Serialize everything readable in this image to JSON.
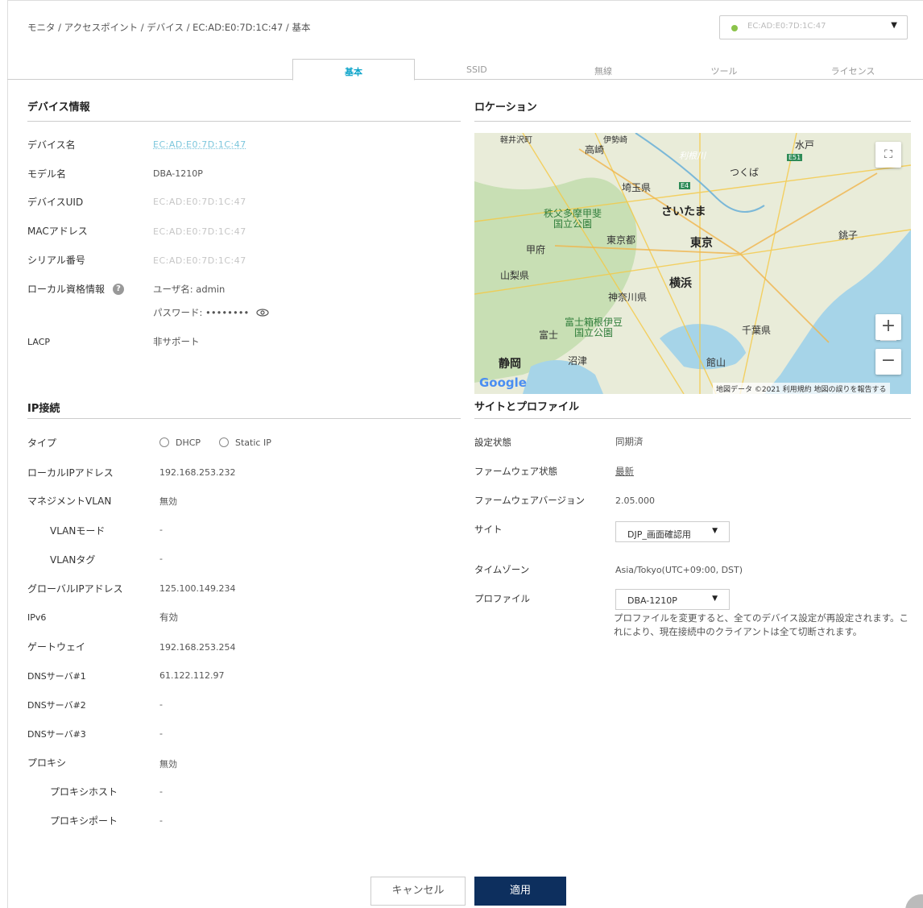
{
  "breadcrumb": "モニタ / アクセスポイント / デバイス / EC:AD:E0:7D:1C:47 / 基本",
  "device_selector": {
    "value": "EC:AD:E0:7D:1C:47",
    "status_color": "#8bc34a"
  },
  "tabs": [
    {
      "label": "基本",
      "active": true
    },
    {
      "label": "SSID"
    },
    {
      "label": "無線"
    },
    {
      "label": "ツール"
    },
    {
      "label": "ライセンス"
    }
  ],
  "device_info": {
    "title": "デバイス情報",
    "device_name_label": "デバイス名",
    "device_name_value": "EC:AD:E0:7D:1C:47",
    "model_label": "モデル名",
    "model_value": "DBA-1210P",
    "uid_label": "デバイスUID",
    "uid_value": "EC:AD:E0:7D:1C:47",
    "mac_label": "MACアドレス",
    "mac_value": "EC:AD:E0:7D:1C:47",
    "serial_label": "シリアル番号",
    "serial_value": "EC:AD:E0:7D:1C:47",
    "credentials_label": "ローカル資格情報",
    "username_text": "ユーザ名: admin",
    "password_text": "パスワード: ••••••••",
    "lacp_label": "LACP",
    "lacp_value": "非サポート"
  },
  "ip": {
    "title": "IP接続",
    "type_label": "タイプ",
    "dhcp_label": "DHCP",
    "static_label": "Static IP",
    "local_ip_label": "ローカルIPアドレス",
    "local_ip_value": "192.168.253.232",
    "mgmt_vlan_label": "マネジメントVLAN",
    "mgmt_vlan_value": "無効",
    "vlan_mode_label": "VLANモード",
    "vlan_mode_value": "-",
    "vlan_tag_label": "VLANタグ",
    "vlan_tag_value": "-",
    "global_ip_label": "グローバルIPアドレス",
    "global_ip_value": "125.100.149.234",
    "ipv6_label": "IPv6",
    "ipv6_value": "有効",
    "gateway_label": "ゲートウェイ",
    "gateway_value": "192.168.253.254",
    "dns1_label": "DNSサーバ#1",
    "dns1_value": "61.122.112.97",
    "dns2_label": "DNSサーバ#2",
    "dns2_value": "-",
    "dns3_label": "DNSサーバ#3",
    "dns3_value": "-",
    "proxy_label": "プロキシ",
    "proxy_value": "無効",
    "proxy_host_label": "プロキシホスト",
    "proxy_host_value": "-",
    "proxy_port_label": "プロキシポート",
    "proxy_port_value": "-"
  },
  "location": {
    "title": "ロケーション",
    "map_labels": {
      "karuizawa": "軽井沢町",
      "isesaki": "伊勢崎",
      "takasaki": "高崎",
      "mito": "水戸",
      "tsukuba": "つくば",
      "saitama_pref": "埼玉県",
      "saitama": "さいたま",
      "chichibu": "秩父多摩甲斐\n国立公園",
      "kofu": "甲府",
      "tokyo_to": "東京都",
      "tokyo": "東京",
      "choshi": "銚子",
      "yamanashi": "山梨県",
      "yokohama": "横浜",
      "kanagawa": "神奈川県",
      "fujihakone": "富士箱根伊豆\n国立公園",
      "fuji": "富士",
      "chiba": "千葉県",
      "numazu": "沼津",
      "shizuoka": "静岡",
      "tateyama": "館山",
      "tonegawa": "利根川",
      "e51": "E51",
      "e4": "E4"
    },
    "google": "Google",
    "attribution": "地図データ ©2021   利用規約   地図の誤りを報告する"
  },
  "site_profile": {
    "title": "サイトとプロファイル",
    "config_status_label": "設定状態",
    "config_status_value": "同期済",
    "fw_status_label": "ファームウェア状態",
    "fw_status_value": "最新",
    "fw_version_label": "ファームウェアバージョン",
    "fw_version_value": "2.05.000",
    "site_label": "サイト",
    "site_value": "DJP_画面確認用",
    "timezone_label": "タイムゾーン",
    "timezone_value": "Asia/Tokyo(UTC+09:00, DST)",
    "profile_label": "プロファイル",
    "profile_value": "DBA-1210P",
    "profile_note": "プロファイルを変更すると、全てのデバイス設定が再設定されます。これにより、現在接続中のクライアントは全て切断されます。"
  },
  "buttons": {
    "cancel": "キャンセル",
    "apply": "適用"
  }
}
